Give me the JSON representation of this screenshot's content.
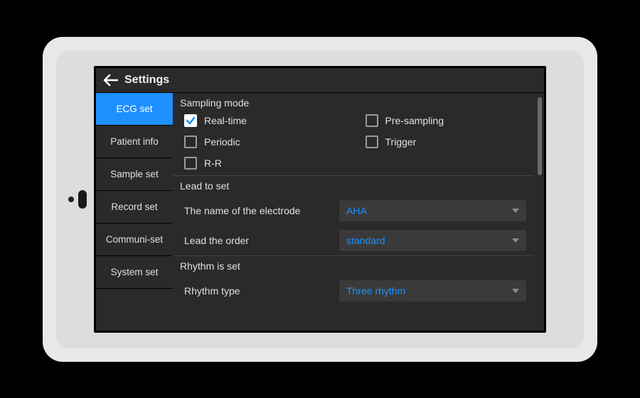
{
  "header": {
    "title": "Settings"
  },
  "sidebar": {
    "items": [
      {
        "label": "ECG set",
        "active": true
      },
      {
        "label": "Patient info",
        "active": false
      },
      {
        "label": "Sample set",
        "active": false
      },
      {
        "label": "Record set",
        "active": false
      },
      {
        "label": "Communi-set",
        "active": false
      },
      {
        "label": "System set",
        "active": false
      }
    ]
  },
  "sections": {
    "sampling_mode": {
      "title": "Sampling mode",
      "options": [
        {
          "label": "Real-time",
          "checked": true
        },
        {
          "label": "Pre-sampling",
          "checked": false
        },
        {
          "label": "Periodic",
          "checked": false
        },
        {
          "label": "Trigger",
          "checked": false
        },
        {
          "label": "R-R",
          "checked": false
        }
      ]
    },
    "lead_to_set": {
      "title": "Lead to set",
      "rows": [
        {
          "label": "The name of the electrode",
          "value": "AHA"
        },
        {
          "label": "Lead the order",
          "value": "standard"
        }
      ]
    },
    "rhythm_set": {
      "title": "Rhythm is set",
      "rows": [
        {
          "label": "Rhythm type",
          "value": "Three rhythm"
        }
      ]
    }
  },
  "colors": {
    "accent": "#1e90ff",
    "bg": "#2a2a2a",
    "field": "#3a3a3a"
  }
}
